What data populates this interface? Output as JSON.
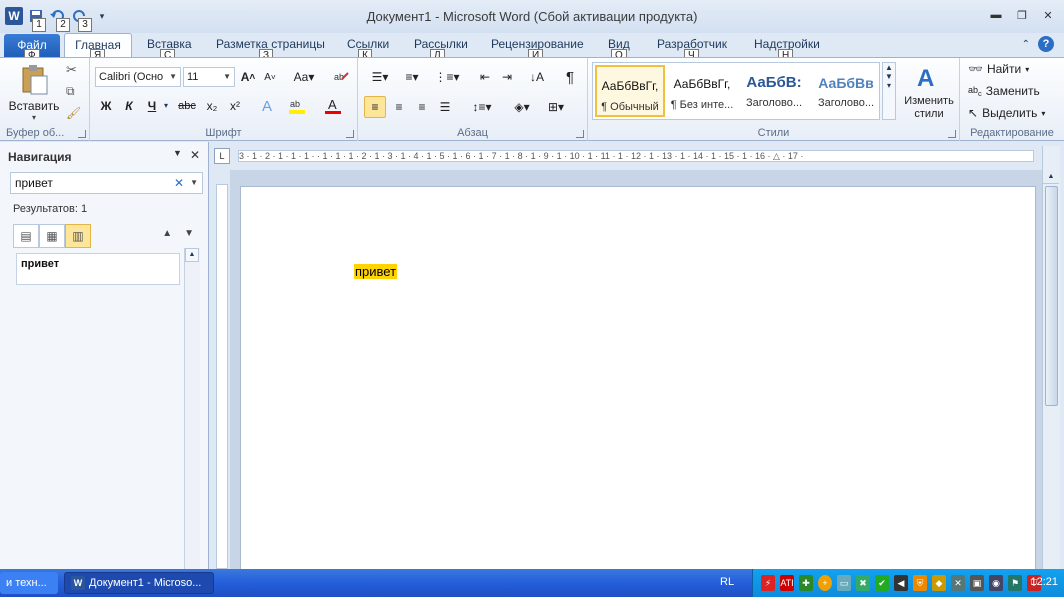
{
  "window": {
    "title": "Документ1  -  Microsoft Word (Сбой активации продукта)",
    "qat_keytips": [
      "1",
      "2",
      "3"
    ]
  },
  "tabs": {
    "file": "Файл",
    "items": [
      "Главная",
      "Вставка",
      "Разметка страницы",
      "Ссылки",
      "Рассылки",
      "Рецензирование",
      "Вид",
      "Разработчик",
      "Надстройки"
    ],
    "keytips": [
      "Ф",
      "Я",
      "С",
      "З",
      "К",
      "Л",
      "И",
      "О",
      "Ч",
      "Н"
    ]
  },
  "ribbon": {
    "clipboard": {
      "paste": "Вставить",
      "label": "Буфер об..."
    },
    "font": {
      "name": "Calibri (Осно",
      "size": "11",
      "label": "Шрифт",
      "bold": "Ж",
      "italic": "К",
      "underline": "Ч",
      "strike": "abc",
      "sub": "x₂",
      "sup": "x²",
      "grow": "A",
      "shrink": "A",
      "case": "Aa"
    },
    "paragraph": {
      "label": "Абзац",
      "pilcrow": "¶"
    },
    "styles": {
      "label": "Стили",
      "items": [
        {
          "preview": "АаБбВвГг,",
          "name": "¶ Обычный"
        },
        {
          "preview": "АаБбВвГг,",
          "name": "¶ Без инте..."
        },
        {
          "preview": "АаБбВ:",
          "name": "Заголово..."
        },
        {
          "preview": "АаБбВв",
          "name": "Заголово..."
        }
      ],
      "change": "Изменить стили"
    },
    "editing": {
      "label": "Редактирование",
      "find": "Найти",
      "replace": "Заменить",
      "select": "Выделить"
    }
  },
  "nav": {
    "title": "Навигация",
    "search_value": "привет",
    "results": "Результатов: 1",
    "result_item": "привет"
  },
  "ruler": "3 · 1 · 2 · 1 · 1 · 1 ·  · 1 · 1 · 1 · 2 · 1 · 3 · 1 · 4 · 1 · 5 · 1 · 6 · 1 · 7 · 1 · 8 · 1 · 9 · 1 · 10 · 1 · 11 · 1 · 12 · 1 · 13 · 1 · 14 · 1 · 15 · 1 · 16 · △ · 17 ·",
  "document": {
    "text": "привет"
  },
  "taskbar": {
    "task1": "и техн...",
    "task2": "Документ1 - Microso...",
    "lang": "RL",
    "clock": "12:21"
  }
}
